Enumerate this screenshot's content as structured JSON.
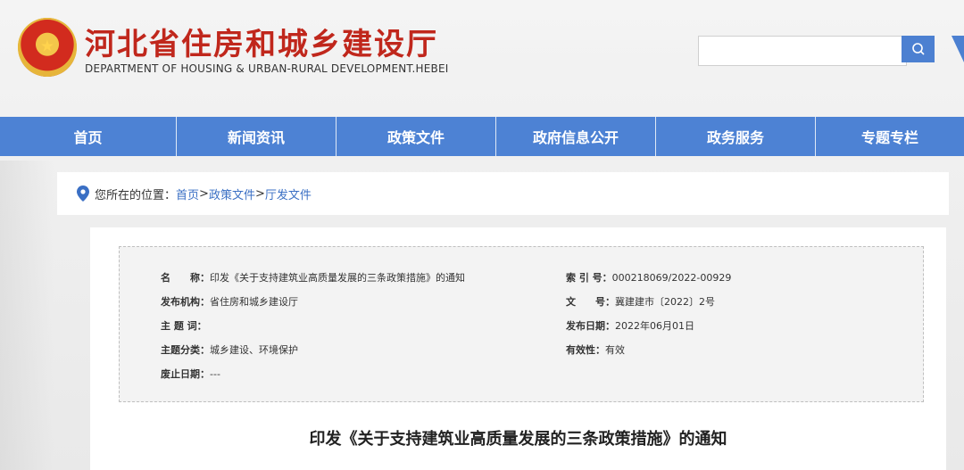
{
  "header": {
    "title_cn": "河北省住房和城乡建设厅",
    "title_en": "DEPARTMENT OF HOUSING & URBAN-RURAL DEVELOPMENT.HEBEI",
    "search_placeholder": ""
  },
  "nav": {
    "items": [
      {
        "label": "首页"
      },
      {
        "label": "新闻资讯"
      },
      {
        "label": "政策文件"
      },
      {
        "label": "政府信息公开"
      },
      {
        "label": "政务服务"
      },
      {
        "label": "专题专栏"
      }
    ]
  },
  "breadcrumb": {
    "label": "您所在的位置：",
    "links": [
      "首页",
      "政策文件",
      "厅发文件"
    ],
    "separator": ">"
  },
  "info": {
    "name_key": "名　　称：",
    "name_val": "印发《关于支持建筑业高质量发展的三条政策措施》的通知",
    "index_key": "索 引 号：",
    "index_val": "000218069/2022-00929",
    "publisher_key": "发布机构：",
    "publisher_val": "省住房和城乡建设厅",
    "docno_key": "文　　号：",
    "docno_val": "冀建建市〔2022〕2号",
    "subject_key": "主 题 词：",
    "subject_val": "",
    "date_key": "发布日期：",
    "date_val": "2022年06月01日",
    "category_key": "主题分类：",
    "category_val": "城乡建设、环境保护",
    "validity_key": "有效性：",
    "validity_val": "有效",
    "abolish_key": "废止日期：",
    "abolish_val": "---"
  },
  "document": {
    "title": "印发《关于支持建筑业高质量发展的三条政策措施》的通知"
  },
  "colors": {
    "nav": "#4d82d4",
    "title_red": "#c0271c",
    "link": "#3a6fc4"
  }
}
